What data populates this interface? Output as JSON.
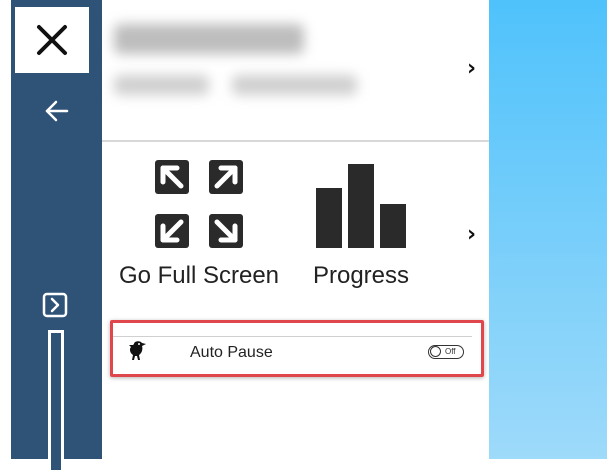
{
  "sidebar": {
    "close_icon": "close-icon",
    "back_icon": "arrow-left-icon",
    "expand_icon": "chevron-right-box-icon"
  },
  "user": {
    "name": "",
    "details": ""
  },
  "tiles": [
    {
      "label": "Go Full Screen",
      "icon": "fullscreen-icon"
    },
    {
      "label": "Progress",
      "icon": "bar-chart-icon"
    }
  ],
  "settings": {
    "auto_pause": {
      "label": "Auto Pause",
      "state": "off",
      "toggle_text": "Off",
      "icon": "bird-icon"
    }
  },
  "colors": {
    "sidebar": "#2f5277",
    "highlight": "#e0474c",
    "sky_top": "#4fc2fb",
    "sky_bottom": "#9edafa"
  }
}
